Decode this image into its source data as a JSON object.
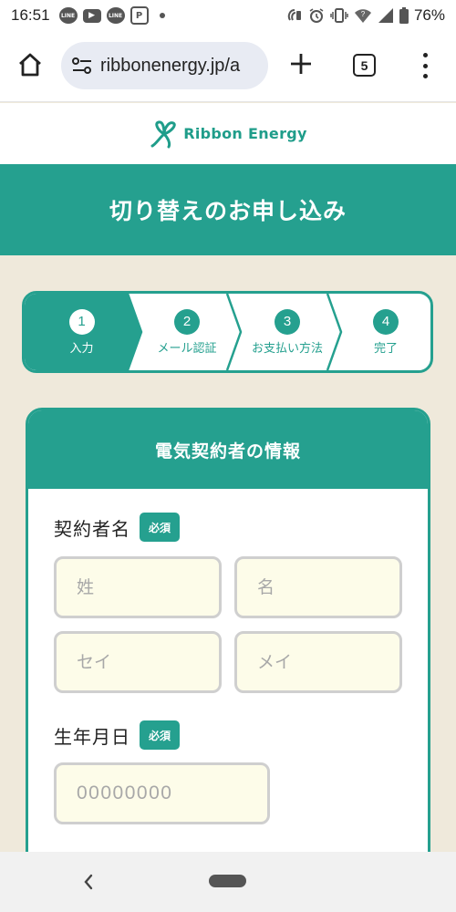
{
  "status_bar": {
    "time": "16:51",
    "battery": "76%",
    "notifications": [
      "LINE",
      "▶",
      "LINE",
      "P"
    ]
  },
  "browser": {
    "url": "ribbonenergy.jp/a",
    "tab_count": "5"
  },
  "logo": {
    "text": "Ribbon Energy",
    "color": "#1f9d8a"
  },
  "page": {
    "title": "切り替えのお申し込み"
  },
  "stepper": {
    "current_step": 1,
    "steps": [
      {
        "num": "1",
        "label": "入力"
      },
      {
        "num": "2",
        "label": "メール認証"
      },
      {
        "num": "3",
        "label": "お支払い方法"
      },
      {
        "num": "4",
        "label": "完了"
      }
    ]
  },
  "form": {
    "section_title": "電気契約者の情報",
    "name_label": "契約者名",
    "required_badge": "必須",
    "last_name_placeholder": "姓",
    "first_name_placeholder": "名",
    "last_kana_placeholder": "セイ",
    "first_kana_placeholder": "メイ",
    "birthdate_label": "生年月日",
    "birthdate_placeholder": "00000000"
  },
  "colors": {
    "accent": "#25a08f",
    "page_bg": "#efe9db",
    "input_bg": "#fdfce9"
  }
}
